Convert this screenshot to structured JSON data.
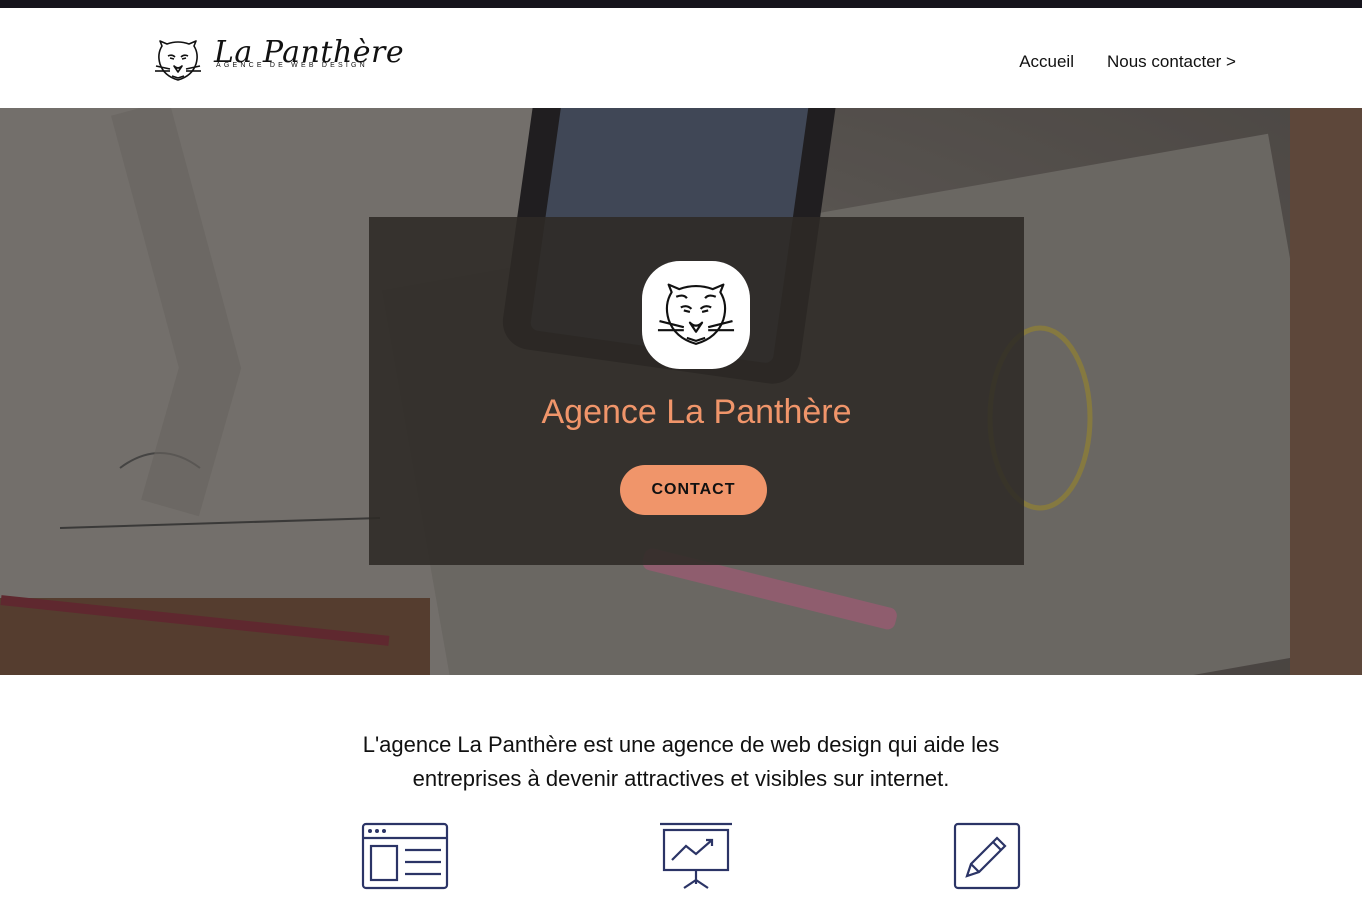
{
  "brand": {
    "name": "La Panthère",
    "tagline": "AGENCE DE WEB DESIGN"
  },
  "nav": {
    "items": [
      "Accueil",
      "Nous contacter >"
    ]
  },
  "hero": {
    "title": "Agence La Panthère",
    "cta_label": "CONTACT"
  },
  "intro": {
    "line1": "L'agence La Panthère est une agence de web design qui aide les",
    "line2": "entreprises à devenir attractives et visibles sur internet."
  },
  "features": {
    "icons": [
      "web-layout-icon",
      "presentation-chart-icon",
      "pencil-edit-icon"
    ]
  },
  "colors": {
    "accent": "#f0956a",
    "icon_stroke": "#2b3466",
    "topbar": "#16141c"
  }
}
